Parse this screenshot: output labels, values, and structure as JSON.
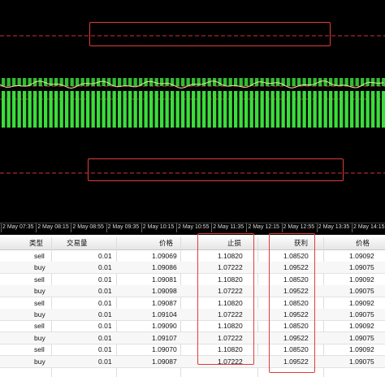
{
  "axis": {
    "ticks": [
      "2 May 07:35",
      "2 May 08:15",
      "2 May 08:55",
      "2 May 09:35",
      "2 May 10:15",
      "2 May 10:55",
      "2 May 11:35",
      "2 May 12:15",
      "2 May 12:55",
      "2 May 13:35",
      "2 May 14:15"
    ]
  },
  "table": {
    "headers": {
      "type": "类型",
      "volume": "交易量",
      "price": "价格",
      "sl": "止损",
      "tp": "获利",
      "price2": "价格"
    },
    "rows": [
      {
        "type": "sell",
        "volume": "0.01",
        "price": "1.09069",
        "sl": "1.10820",
        "tp": "1.08520",
        "price2": "1.09092"
      },
      {
        "type": "buy",
        "volume": "0.01",
        "price": "1.09086",
        "sl": "1.07222",
        "tp": "1.09522",
        "price2": "1.09075"
      },
      {
        "type": "sell",
        "volume": "0.01",
        "price": "1.09081",
        "sl": "1.10820",
        "tp": "1.08520",
        "price2": "1.09092"
      },
      {
        "type": "buy",
        "volume": "0.01",
        "price": "1.09098",
        "sl": "1.07222",
        "tp": "1.09522",
        "price2": "1.09075"
      },
      {
        "type": "sell",
        "volume": "0.01",
        "price": "1.09087",
        "sl": "1.10820",
        "tp": "1.08520",
        "price2": "1.09092"
      },
      {
        "type": "buy",
        "volume": "0.01",
        "price": "1.09104",
        "sl": "1.07222",
        "tp": "1.09522",
        "price2": "1.09075"
      },
      {
        "type": "sell",
        "volume": "0.01",
        "price": "1.09090",
        "sl": "1.10820",
        "tp": "1.08520",
        "price2": "1.09092"
      },
      {
        "type": "buy",
        "volume": "0.01",
        "price": "1.09107",
        "sl": "1.07222",
        "tp": "1.09522",
        "price2": "1.09075"
      },
      {
        "type": "sell",
        "volume": "0.01",
        "price": "1.09070",
        "sl": "1.10820",
        "tp": "1.08520",
        "price2": "1.09092"
      },
      {
        "type": "buy",
        "volume": "0.01",
        "price": "1.09087",
        "sl": "1.07222",
        "tp": "1.09522",
        "price2": "1.09075"
      }
    ]
  },
  "colors": {
    "bars": "#3cdc3c",
    "levels": "#d23232",
    "highlight": "#e23b3b"
  }
}
